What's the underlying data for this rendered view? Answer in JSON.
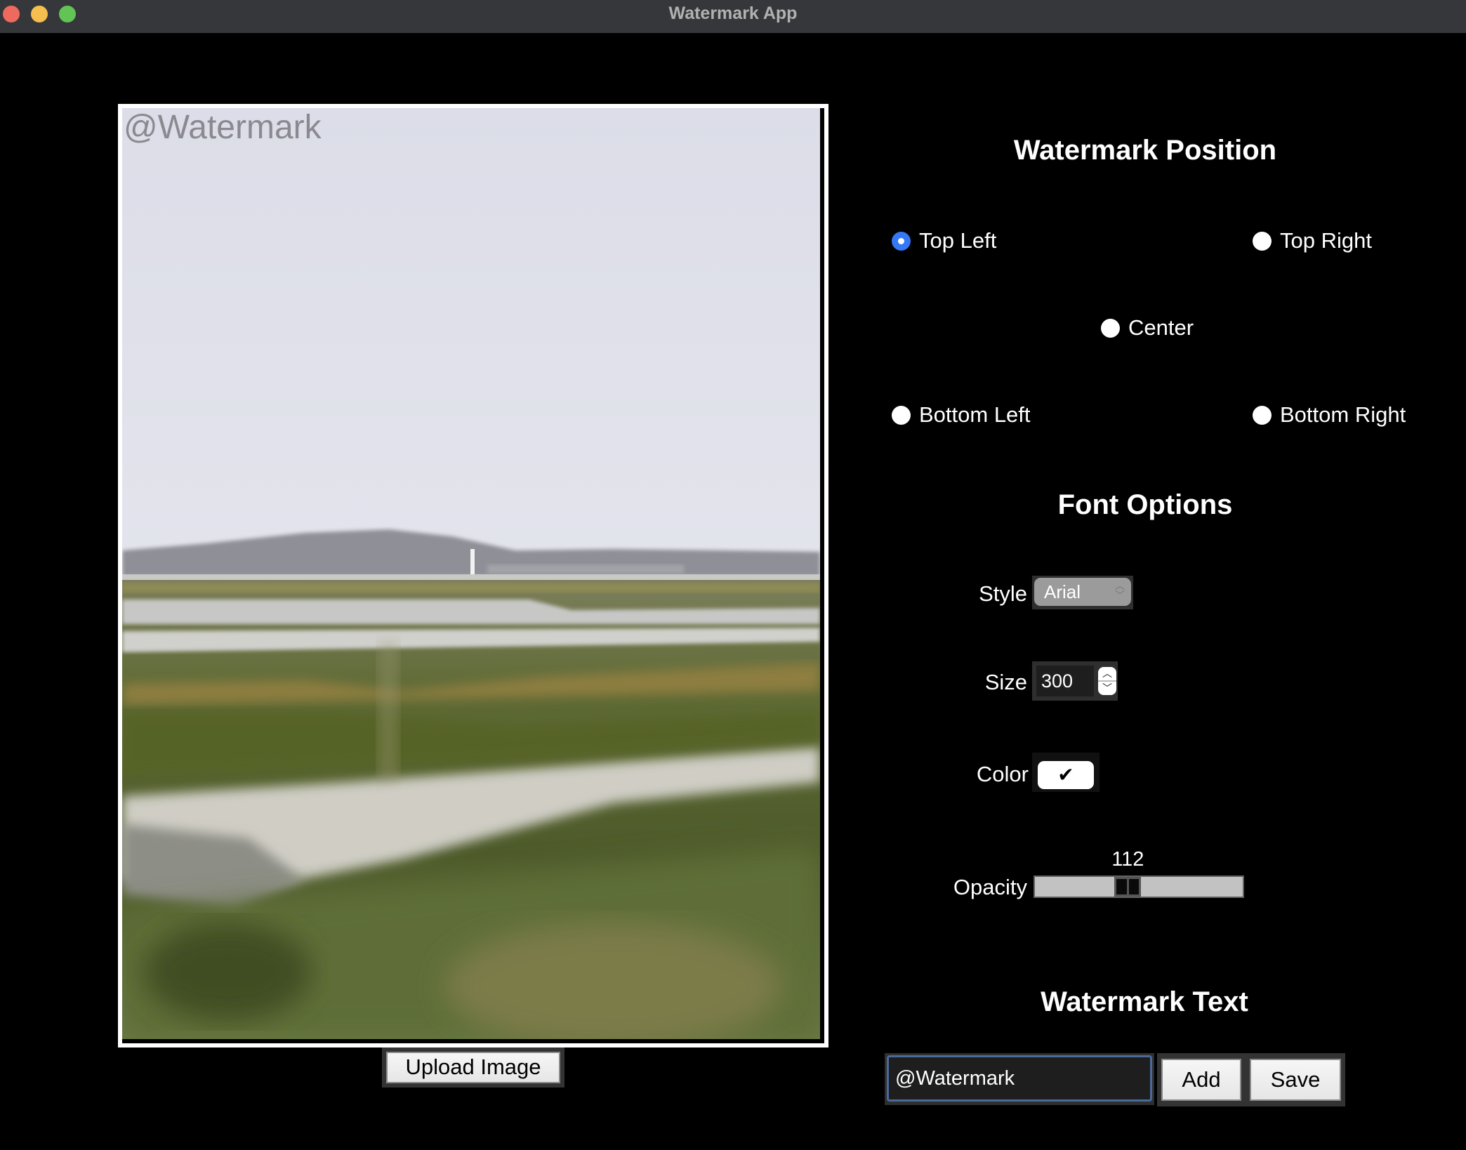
{
  "window": {
    "title": "Watermark App",
    "controls": [
      "close",
      "minimize",
      "maximize"
    ]
  },
  "image_panel": {
    "watermark_overlay_text": "@Watermark",
    "upload_button": "Upload Image"
  },
  "position_section": {
    "heading": "Watermark Position",
    "options": [
      {
        "label": "Top Left",
        "selected": true
      },
      {
        "label": "Top Right",
        "selected": false
      },
      {
        "label": "Center",
        "selected": false
      },
      {
        "label": "Bottom Left",
        "selected": false
      },
      {
        "label": "Bottom Right",
        "selected": false
      }
    ],
    "accent_color": "#3478f6"
  },
  "font_section": {
    "heading": "Font Options",
    "style_label": "Style",
    "style_value": "Arial",
    "size_label": "Size",
    "size_value": "300",
    "color_label": "Color",
    "color_button_glyph": "✔",
    "color_value": "#ffffff",
    "opacity_label": "Opacity",
    "opacity_value": "112",
    "opacity_min": 0,
    "opacity_max": 255
  },
  "text_section": {
    "heading": "Watermark Text",
    "entry_value": "@Watermark",
    "add_button": "Add",
    "save_button": "Save"
  }
}
